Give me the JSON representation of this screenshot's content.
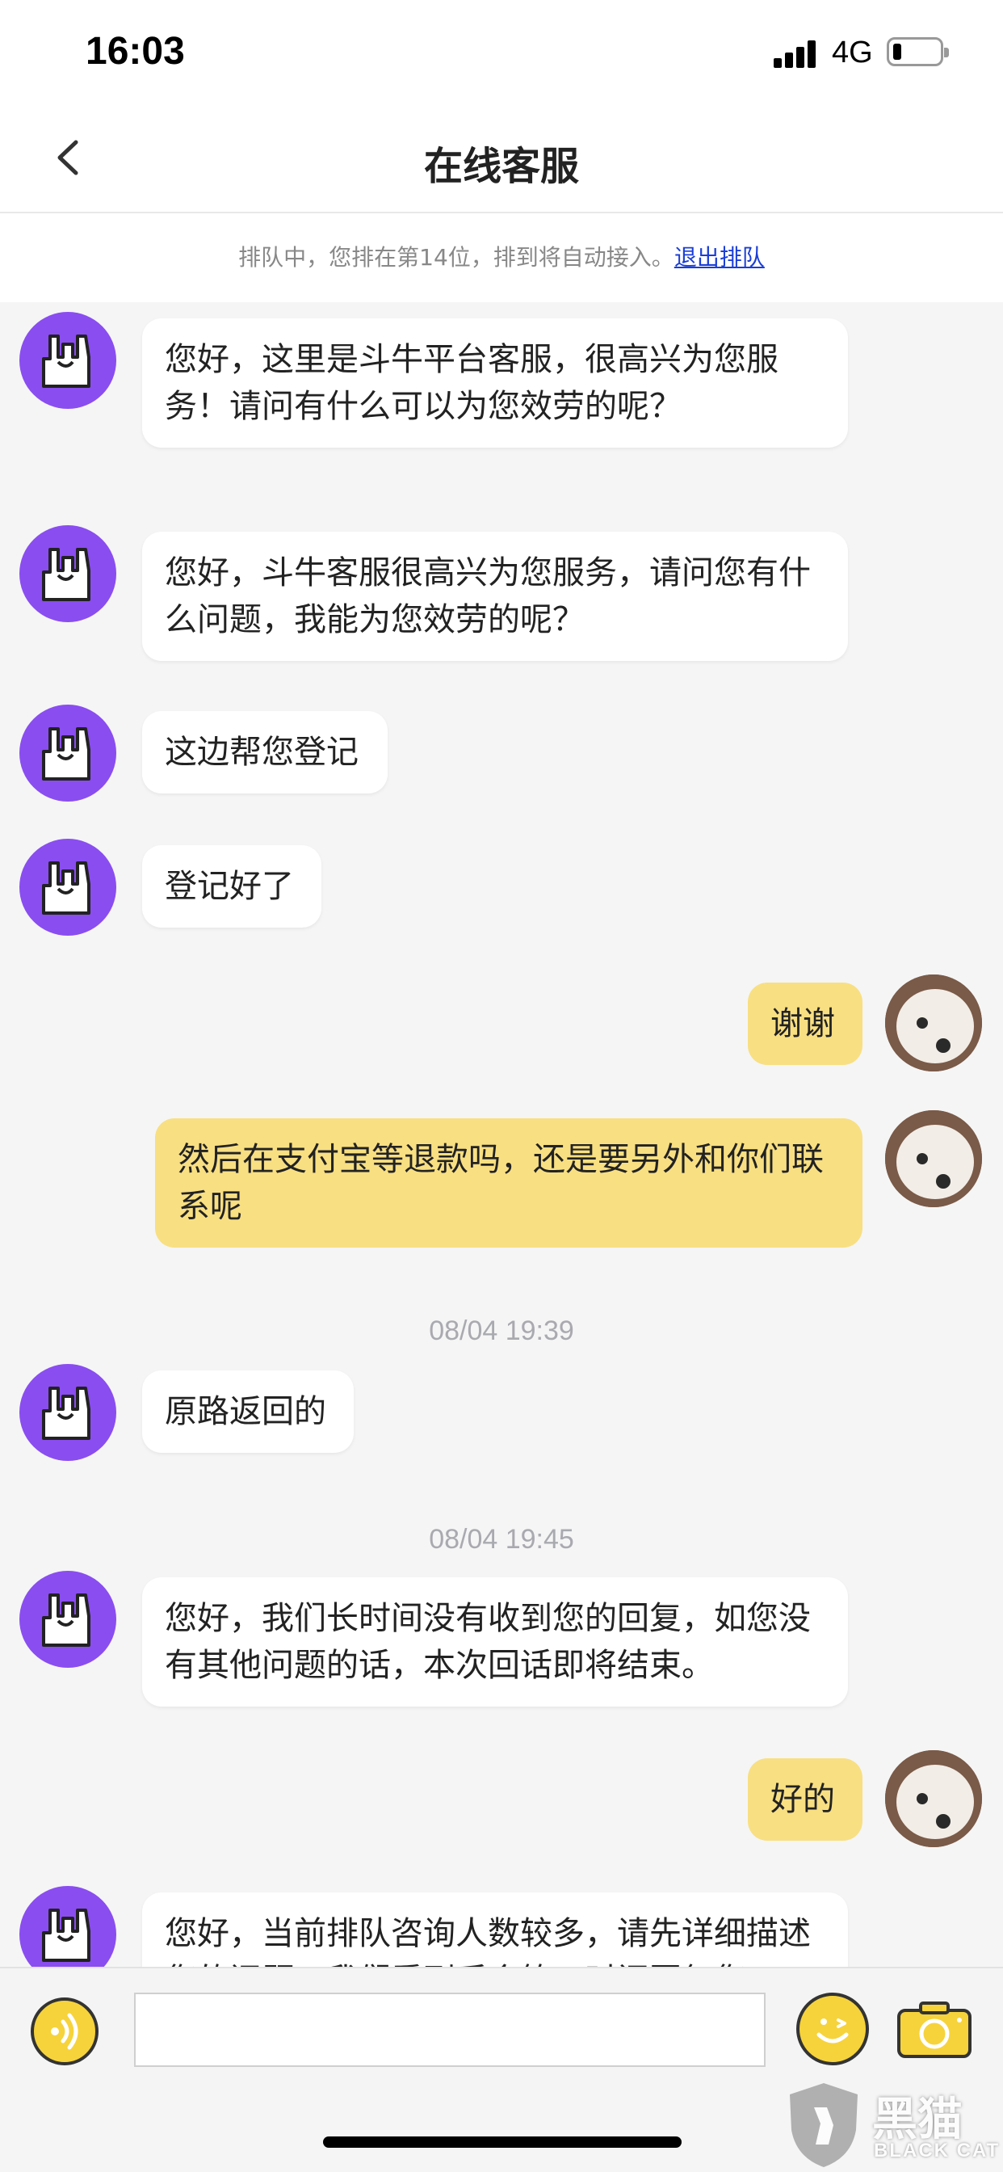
{
  "status_bar": {
    "time": "16:03",
    "network": "4G"
  },
  "nav": {
    "title": "在线客服"
  },
  "queue": {
    "text": "排队中，您排在第14位，排到将自动接入。",
    "link": "退出排队"
  },
  "messages": [
    {
      "text": "您好，这里是斗牛平台客服，很高兴为您服务！请问有什么可以为您效劳的呢？"
    },
    {
      "text": "您好，斗牛客服很高兴为您服务，请问您有什么问题，我能为您效劳的呢？"
    },
    {
      "text": "这边帮您登记"
    },
    {
      "text": "登记好了"
    },
    {
      "text": "谢谢"
    },
    {
      "text": "然后在支付宝等退款吗，还是要另外和你们联系呢"
    },
    {
      "text": "08/04 19:39"
    },
    {
      "text": "原路返回的"
    },
    {
      "text": "08/04 19:45"
    },
    {
      "text": "您好，我们长时间没有收到您的回复，如您没有其他问题的话，本次回话即将结束。"
    },
    {
      "text": "好的"
    },
    {
      "text": "您好，当前排队咨询人数较多，请先详细描述您的问题，我们看到后会第一时间回复您。"
    }
  ],
  "input": {
    "placeholder": "",
    "value": ""
  },
  "watermark": {
    "name": "黑猫",
    "sub": "BLACK CAT"
  },
  "icons": {
    "back": "chevron-left-icon",
    "bot_avatar": "rock-hand-icon",
    "user_avatar": "dog-photo",
    "voice": "voice-icon",
    "emoji": "smile-icon",
    "camera": "camera-icon"
  },
  "colors": {
    "accent": "#f8df82",
    "bot_avatar": "#8a4df0",
    "link": "#1a3ed6"
  }
}
